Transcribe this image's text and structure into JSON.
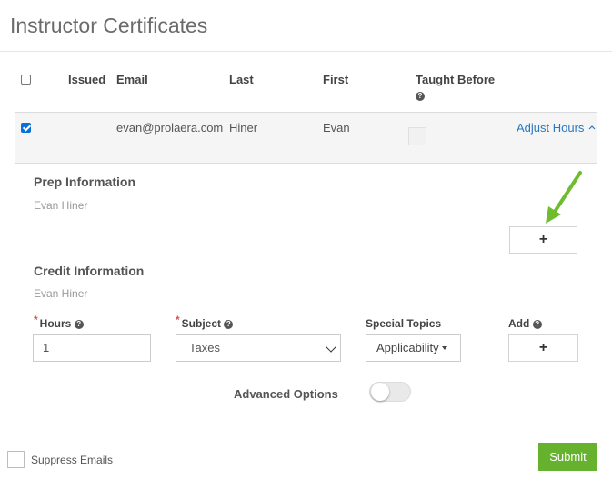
{
  "page": {
    "title": "Instructor Certificates"
  },
  "table": {
    "headers": {
      "issued": "Issued",
      "email": "Email",
      "last": "Last",
      "first": "First",
      "taught_before": "Taught Before"
    },
    "row": {
      "email": "evan@prolaera.com",
      "last": "Hiner",
      "first": "Evan",
      "adjust_label": "Adjust Hours",
      "checked": true
    }
  },
  "prep": {
    "title": "Prep Information",
    "name": "Evan Hiner",
    "add_symbol": "+"
  },
  "credit": {
    "title": "Credit Information",
    "name": "Evan Hiner",
    "hours_label": "Hours",
    "hours_value": "1",
    "subject_label": "Subject",
    "subject_value": "Taxes",
    "special_topics_label": "Special Topics",
    "special_topics_value": "Applicability",
    "add_label": "Add",
    "add_symbol": "+",
    "required_mark": "*",
    "help_glyph": "?"
  },
  "advanced": {
    "label": "Advanced Options",
    "enabled": false
  },
  "footer": {
    "suppress_label": "Suppress Emails",
    "submit_label": "Submit"
  },
  "colors": {
    "accent_link": "#2a78bf",
    "submit": "#66b22e",
    "arrow": "#6fbd2e",
    "required": "#d9534f"
  },
  "icons": {
    "help": "question-circle-icon",
    "add": "plus-icon",
    "adjust": "chevron-up-icon",
    "arrow": "arrow-down-left-icon"
  }
}
